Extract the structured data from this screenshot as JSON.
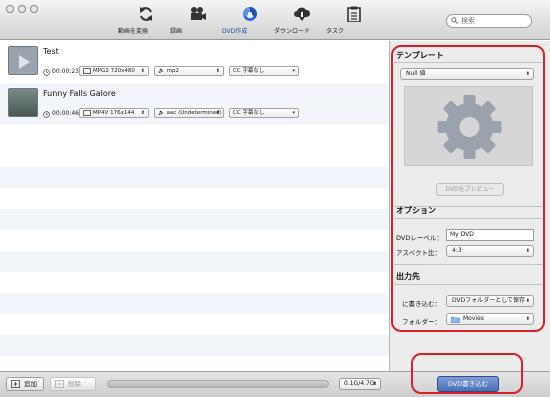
{
  "toolbar": {
    "convert_label": "動画を変換",
    "record_label": "録画",
    "dvd_label": "DVD作成",
    "download_label": "ダウンロード",
    "task_label": "タスク"
  },
  "search": {
    "placeholder": "検索"
  },
  "files": [
    {
      "title": "Test",
      "duration": "00:00:23",
      "video_format": "MPG2 720x480",
      "audio_format": "mp2",
      "subtitle": "CC 字幕なし"
    },
    {
      "title": "Funny Falls Galore",
      "duration": "00:00:46",
      "video_format": "MP4V 176x144",
      "audio_format": "aac (Undetermined)",
      "subtitle": "CC 字幕なし"
    }
  ],
  "panel": {
    "template_title": "テンプレート",
    "template_select": "Null 値",
    "preview_button": "DVDをプレビュー",
    "options_title": "オプション",
    "dvd_label_label": "DVDレーベル：",
    "dvd_label_value": "My DVD",
    "aspect_label": "アスペクト比：",
    "aspect_value": "4:3",
    "output_title": "出力先",
    "write_to_label": "に書き込む：",
    "write_to_value": "DVDフォルダーとして保存",
    "folder_label": "フォルダー：",
    "folder_value": "Movies"
  },
  "bottom": {
    "add_label": "追加",
    "delete_label": "削除",
    "size_value": "0.1G/4.7G",
    "burn_label": "DVD書き込む"
  }
}
